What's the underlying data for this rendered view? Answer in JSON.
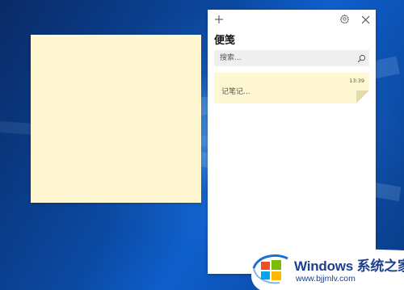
{
  "panel": {
    "title": "便笺",
    "icons": {
      "add": "plus-icon",
      "settings": "gear-icon",
      "close": "close-icon",
      "search": "search-icon"
    }
  },
  "search": {
    "placeholder": "搜索..."
  },
  "notes": [
    {
      "time": "13:39",
      "text": "记笔记..."
    }
  ],
  "colors": {
    "note_yellow": "#fff7d1",
    "panel_bg": "#ffffff",
    "search_bg": "#efefef"
  },
  "watermark": {
    "title": "Windows 系统之家",
    "url": "www.bjjmlv.com"
  }
}
